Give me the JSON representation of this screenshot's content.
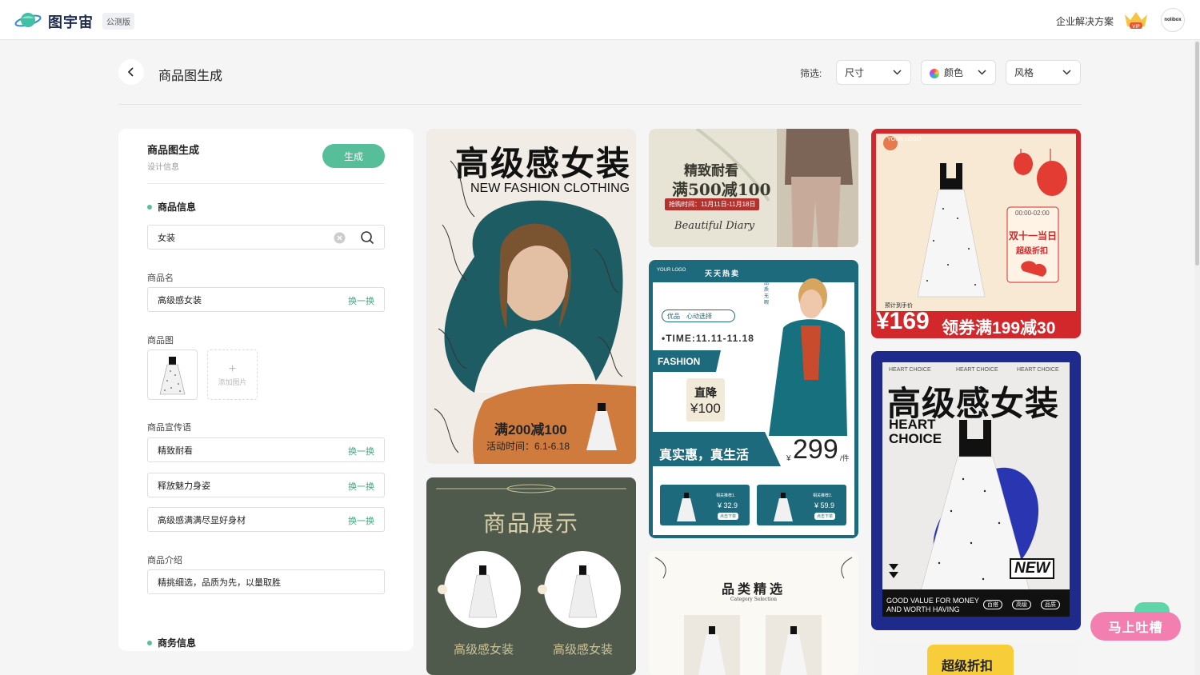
{
  "app": {
    "brand": "图宇宙",
    "badge": "公测版",
    "enterprise_link": "企业解决方案",
    "vip_label": "VIP",
    "avatar_text": "nolibox"
  },
  "page": {
    "title": "商品图生成",
    "filter_label": "筛选:",
    "filters": {
      "size": "尺寸",
      "color": "颜色",
      "style": "风格"
    }
  },
  "panel": {
    "title": "商品图生成",
    "subtitle": "设计信息",
    "generate_label": "生成",
    "section_product": "商品信息",
    "search_value": "女装",
    "name_label": "商品名",
    "name_value": "高级感女装",
    "swap_label": "换一换",
    "image_label": "商品图",
    "add_image_label": "添加图片",
    "slogan_label": "商品宣传语",
    "slogans": [
      "精致耐看",
      "释放魅力身姿",
      "高级感满满尽显好身材"
    ],
    "intro_label": "商品介绍",
    "intro_value": "精挑细选，品质为先，以量取胜",
    "section_business": "商务信息"
  },
  "cards": {
    "c1": {
      "title": "高级感女装",
      "subtitle": "NEW FASHION CLOTHING",
      "promo": "满200减100",
      "promo_time": "活动时间：6.1-6.18"
    },
    "c2": {
      "title": "商品展示",
      "item1": "高级感女装",
      "item2": "高级感女装"
    },
    "c3": {
      "line1": "精致耐看",
      "line2": "满500减100",
      "line3": "抢购时间：11月11日-11月18日",
      "signature": "Beautiful Diary"
    },
    "c4": {
      "logo": "YOUR LOGO",
      "header": "天天热卖",
      "tag1": "优品",
      "tag2": "心动选择",
      "time": "•TIME:11.11-11.18",
      "fashion": "FASHION",
      "side": "品质无暇",
      "drop_label": "直降",
      "drop_value": "¥100",
      "slogan": "真实惠，真生活",
      "price_currency": "¥",
      "price": "299",
      "price_unit": "/件",
      "rec1_title": "相关推荐1.",
      "rec1_price": "¥ 32.9",
      "rec2_title": "相关推荐2.",
      "rec2_price": "¥ 59.9",
      "rec_btn": "点击下单"
    },
    "c5": {
      "title": "品类精选",
      "subtitle": "Category Selection"
    },
    "c6": {
      "logo": "YOUR LOGO",
      "time": "00:00-02:00",
      "line1": "双十一当日",
      "line2": "超级折扣",
      "price_label": "预计到手价",
      "price": "¥169",
      "coupon": "领券满199减30"
    },
    "c7": {
      "small1": "HEART CHOICE",
      "small2": "HEART CHOICE",
      "small3": "HEART CHOICE",
      "title": "高级感女装",
      "sub1": "HEART",
      "sub2": "CHOICE",
      "new": "NEW",
      "foot1": "GOOD VALUE FOR MONEY",
      "foot2": "AND WORTH HAVING",
      "tag1": "百搭",
      "tag2": "高级",
      "tag3": "品质"
    },
    "c8": {
      "title": "超级折扣"
    }
  },
  "feedback": "马上吐槽",
  "colors": {
    "accent": "#56bf9a",
    "card_teal": "#1d6a7d",
    "card_red": "#d3282b",
    "card_navy": "#1e2a8c"
  }
}
